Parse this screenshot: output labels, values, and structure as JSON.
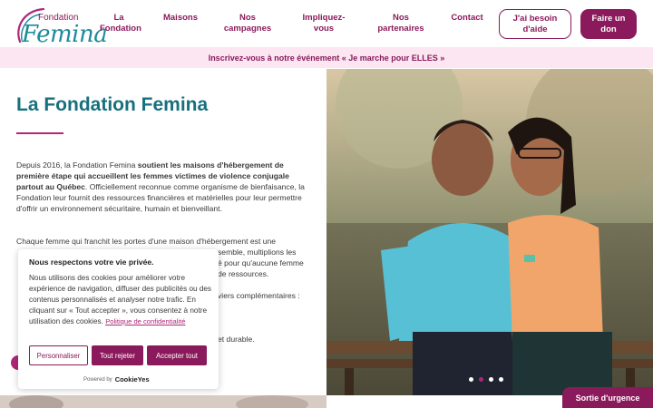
{
  "logo": {
    "top": "Fondation",
    "main": "Femina"
  },
  "nav": [
    {
      "label_line1": "La",
      "label_line2": "Fondation"
    },
    {
      "label_line1": "Maisons",
      "label_line2": ""
    },
    {
      "label_line1": "Nos",
      "label_line2": "campagnes"
    },
    {
      "label_line1": "Impliquez-",
      "label_line2": "vous"
    },
    {
      "label_line1": "Nos",
      "label_line2": "partenaires"
    },
    {
      "label_line1": "Contact",
      "label_line2": ""
    }
  ],
  "cta": {
    "help_line1": "J'ai besoin",
    "help_line2": "d'aide",
    "donate_line1": "Faire un",
    "donate_line2": "don"
  },
  "banner": {
    "text": "Inscrivez-vous à notre événement « Je marche pour ELLES »"
  },
  "main": {
    "title": "La Fondation Femina",
    "p1_intro": "Depuis 2016, la Fondation Femina ",
    "p1_bold": "soutient les maisons d'hébergement de première étape qui accueillent les femmes victimes de violence conjugale partout au Québec",
    "p1_rest": ". Officiellement reconnue comme organisme de bienfaisance, la Fondation leur fournit des ressources financières et matérielles pour leur permettre d'offrir un environnement sécuritaire, humain et bienveillant.",
    "p2_line1": "Chaque femme qui franchit les portes d'une maison d'hébergement est une",
    "p2_line2": "semble, multiplions les",
    "p2_line3": "é pour qu'aucune femme",
    "p2_line4": "de ressources.",
    "p3_line": "viers complémentaires :",
    "p4_line": "et durable."
  },
  "cookie": {
    "title": "Nous respectons votre vie privée.",
    "text": "Nous utilisons des cookies pour améliorer votre expérience de navigation, diffuser des publicités ou des contenus personnalisés et analyser notre trafic. En cliquant sur « Tout accepter », vous consentez à notre utilisation des cookies.",
    "link": "Politique de confidentialité",
    "btn_customize": "Personnaliser",
    "btn_reject": "Tout rejeter",
    "btn_accept": "Accepter tout",
    "powered_by": "Powered by",
    "brand": "CookieYes"
  },
  "sortie": "Sortie d'urgence",
  "colors": {
    "brand": "#8a1a5b",
    "accent": "#b0277a",
    "teal": "#17707d",
    "banner_bg": "#fbe6f1"
  }
}
